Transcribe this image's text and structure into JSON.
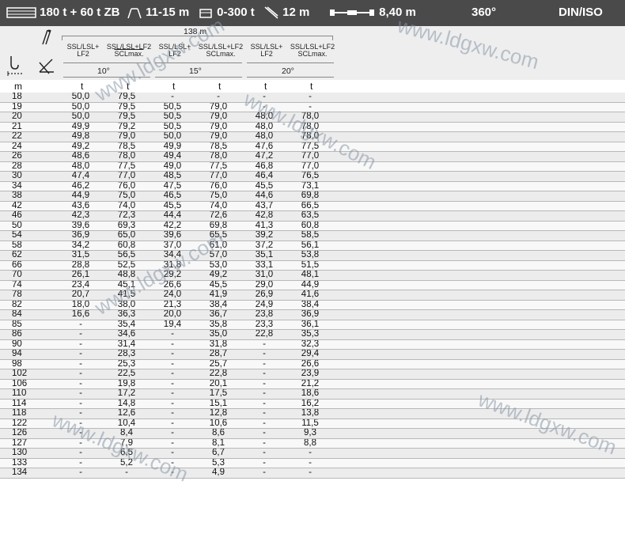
{
  "topbar": {
    "capacity": "180 t + 60 t ZB",
    "outrigger": "11-15 m",
    "counterweight": "0-300 t",
    "jib_length": "12 m",
    "support_base": "8,40 m",
    "slew": "360°",
    "standard": "DIN/ISO"
  },
  "header": {
    "boom_length": "138 m",
    "columns": [
      {
        "line1": "SSL/LSL+",
        "line2": "LF2"
      },
      {
        "line1": "SSL/LSL+LF2",
        "line2": "SCLmax."
      },
      {
        "line1": "SSL/LSL+",
        "line2": "LF2"
      },
      {
        "line1": "SSL/LSL+LF2",
        "line2": "SCLmax."
      },
      {
        "line1": "SSL/LSL+",
        "line2": "LF2"
      },
      {
        "line1": "SSL/LSL+LF2",
        "line2": "SCLmax."
      }
    ],
    "angles": [
      "10°",
      "15°",
      "20°"
    ]
  },
  "units": {
    "radius": "m",
    "load": "t"
  },
  "rows": [
    [
      "18",
      "50,0",
      "79,5",
      "-",
      "-",
      "-",
      "-"
    ],
    [
      "19",
      "50,0",
      "79,5",
      "50,5",
      "79,0",
      "-",
      "-"
    ],
    [
      "20",
      "50,0",
      "79,5",
      "50,5",
      "79,0",
      "48,0",
      "78,0"
    ],
    [
      "21",
      "49,9",
      "79,2",
      "50,5",
      "79,0",
      "48,0",
      "78,0"
    ],
    [
      "22",
      "49,8",
      "79,0",
      "50,0",
      "79,0",
      "48,0",
      "78,0"
    ],
    [
      "24",
      "49,2",
      "78,5",
      "49,9",
      "78,5",
      "47,6",
      "77,5"
    ],
    [
      "26",
      "48,6",
      "78,0",
      "49,4",
      "78,0",
      "47,2",
      "77,0"
    ],
    [
      "28",
      "48,0",
      "77,5",
      "49,0",
      "77,5",
      "46,8",
      "77,0"
    ],
    [
      "30",
      "47,4",
      "77,0",
      "48,5",
      "77,0",
      "46,4",
      "76,5"
    ],
    [
      "34",
      "46,2",
      "76,0",
      "47,5",
      "76,0",
      "45,5",
      "73,1"
    ],
    [
      "38",
      "44,9",
      "75,0",
      "46,5",
      "75,0",
      "44,6",
      "69,8"
    ],
    [
      "42",
      "43,6",
      "74,0",
      "45,5",
      "74,0",
      "43,7",
      "66,5"
    ],
    [
      "46",
      "42,3",
      "72,3",
      "44,4",
      "72,6",
      "42,8",
      "63,5"
    ],
    [
      "50",
      "39,6",
      "69,3",
      "42,2",
      "69,8",
      "41,3",
      "60,8"
    ],
    [
      "54",
      "36,9",
      "65,0",
      "39,6",
      "65,5",
      "39,2",
      "58,5"
    ],
    [
      "58",
      "34,2",
      "60,8",
      "37,0",
      "61,0",
      "37,2",
      "56,1"
    ],
    [
      "62",
      "31,5",
      "56,5",
      "34,4",
      "57,0",
      "35,1",
      "53,8"
    ],
    [
      "66",
      "28,8",
      "52,5",
      "31,8",
      "53,0",
      "33,1",
      "51,5"
    ],
    [
      "70",
      "26,1",
      "48,8",
      "29,2",
      "49,2",
      "31,0",
      "48,1"
    ],
    [
      "74",
      "23,4",
      "45,1",
      "26,6",
      "45,5",
      "29,0",
      "44,9"
    ],
    [
      "78",
      "20,7",
      "41,5",
      "24,0",
      "41,9",
      "26,9",
      "41,6"
    ],
    [
      "82",
      "18,0",
      "38,0",
      "21,3",
      "38,4",
      "24,9",
      "38,4"
    ],
    [
      "84",
      "16,6",
      "36,3",
      "20,0",
      "36,7",
      "23,8",
      "36,9"
    ],
    [
      "85",
      "-",
      "35,4",
      "19,4",
      "35,8",
      "23,3",
      "36,1"
    ],
    [
      "86",
      "-",
      "34,6",
      "-",
      "35,0",
      "22,8",
      "35,3"
    ],
    [
      "90",
      "-",
      "31,4",
      "-",
      "31,8",
      "-",
      "32,3"
    ],
    [
      "94",
      "-",
      "28,3",
      "-",
      "28,7",
      "-",
      "29,4"
    ],
    [
      "98",
      "-",
      "25,3",
      "-",
      "25,7",
      "-",
      "26,6"
    ],
    [
      "102",
      "-",
      "22,5",
      "-",
      "22,8",
      "-",
      "23,9"
    ],
    [
      "106",
      "-",
      "19,8",
      "-",
      "20,1",
      "-",
      "21,2"
    ],
    [
      "110",
      "-",
      "17,2",
      "-",
      "17,5",
      "-",
      "18,6"
    ],
    [
      "114",
      "-",
      "14,8",
      "-",
      "15,1",
      "-",
      "16,2"
    ],
    [
      "118",
      "-",
      "12,6",
      "-",
      "12,8",
      "-",
      "13,8"
    ],
    [
      "122",
      "-",
      "10,4",
      "-",
      "10,6",
      "-",
      "11,5"
    ],
    [
      "126",
      "-",
      "8,4",
      "-",
      "8,6",
      "-",
      "9,3"
    ],
    [
      "127",
      "-",
      "7,9",
      "-",
      "8,1",
      "-",
      "8,8"
    ],
    [
      "130",
      "-",
      "6,5",
      "-",
      "6,7",
      "-",
      "-"
    ],
    [
      "133",
      "-",
      "5,2",
      "-",
      "5,3",
      "-",
      "-"
    ],
    [
      "134",
      "-",
      "-",
      "-",
      "4,9",
      "-",
      "-"
    ]
  ],
  "watermark": "www.ldgxw.com"
}
